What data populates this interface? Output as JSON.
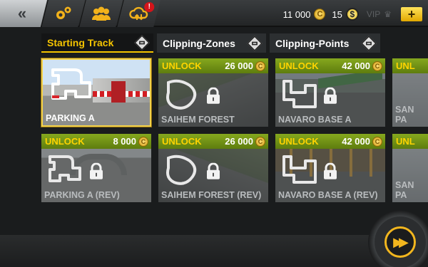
{
  "header": {
    "back_glyph": "«",
    "icons": [
      "gears-icon",
      "team-icon",
      "cloud-sync-icon"
    ],
    "cloud_badge": "!",
    "coins": "11 000",
    "coin_glyph": "C",
    "cash": "15",
    "cash_glyph": "$",
    "vip": "VIP",
    "plus": "+"
  },
  "tabs": [
    {
      "label": "Starting Track",
      "active": true
    },
    {
      "label": "Clipping-Zones",
      "active": false
    },
    {
      "label": "Clipping-Points",
      "active": false
    }
  ],
  "tracks": [
    {
      "name": "PARKING A",
      "locked": false,
      "selected": true
    },
    {
      "name": "SAIHEM FOREST",
      "locked": true,
      "unlock": "UNLOCK",
      "price": "26 000"
    },
    {
      "name": "NAVARO BASE A",
      "locked": true,
      "unlock": "UNLOCK",
      "price": "42 000"
    },
    {
      "name": "SAN PA",
      "locked": true,
      "unlock": "UNL",
      "price": ""
    },
    {
      "name": "PARKING A (REV)",
      "locked": true,
      "unlock": "UNLOCK",
      "price": "8 000"
    },
    {
      "name": "SAIHEM FOREST (REV)",
      "locked": true,
      "unlock": "UNLOCK",
      "price": "26 000"
    },
    {
      "name": "NAVARO BASE A (REV)",
      "locked": true,
      "unlock": "UNLOCK",
      "price": "42 000"
    },
    {
      "name": "SAN PA",
      "locked": true,
      "unlock": "UNL",
      "price": ""
    }
  ],
  "footer": {
    "go_glyph": "▶▶"
  },
  "colors": {
    "accent": "#f5c400",
    "unlock_bar": "#6f8f15",
    "selected_border": "#f4d24a"
  }
}
